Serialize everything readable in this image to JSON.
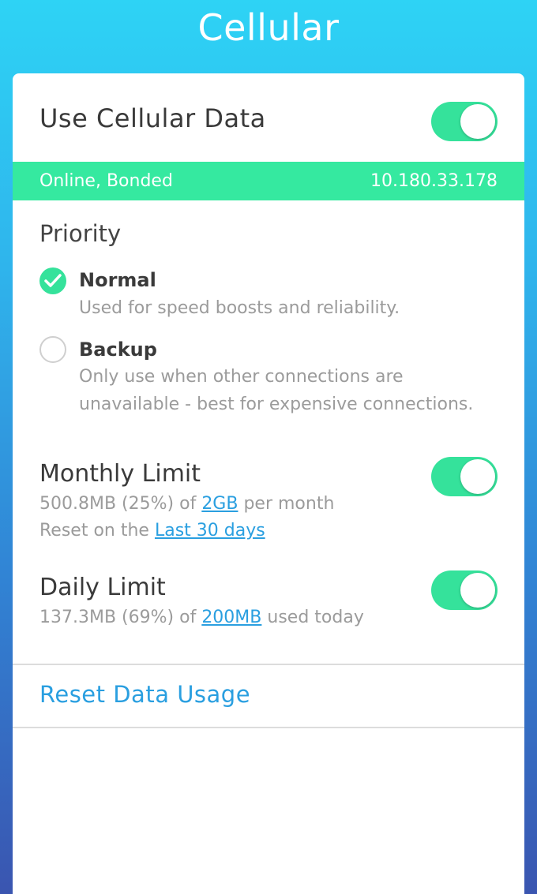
{
  "header": {
    "title": "Cellular"
  },
  "cellular": {
    "label": "Use Cellular Data",
    "enabled": true
  },
  "status": {
    "text": "Online, Bonded",
    "ip": "10.180.33.178"
  },
  "priority": {
    "title": "Priority",
    "options": [
      {
        "label": "Normal",
        "description": "Used for speed boosts and reliability.",
        "selected": true
      },
      {
        "label": "Backup",
        "description": "Only use when other connections are unavailable - best for expensive connections.",
        "selected": false
      }
    ]
  },
  "monthly": {
    "title": "Monthly Limit",
    "enabled": true,
    "usage_prefix": "500.8MB (25%) of ",
    "limit": "2GB",
    "usage_suffix": " per month",
    "reset_prefix": "Reset on the ",
    "reset_period": "Last 30 days"
  },
  "daily": {
    "title": "Daily Limit",
    "enabled": true,
    "usage_prefix": "137.3MB (69%) of ",
    "limit": "200MB",
    "usage_suffix": " used today"
  },
  "actions": {
    "reset_label": "Reset Data Usage"
  },
  "colors": {
    "accent_green": "#35e29b",
    "link_blue": "#2a9fe0",
    "gradient_top": "#2ed3f5",
    "gradient_bottom": "#3a55b0"
  },
  "icons": {
    "checkmark": "check-icon"
  }
}
